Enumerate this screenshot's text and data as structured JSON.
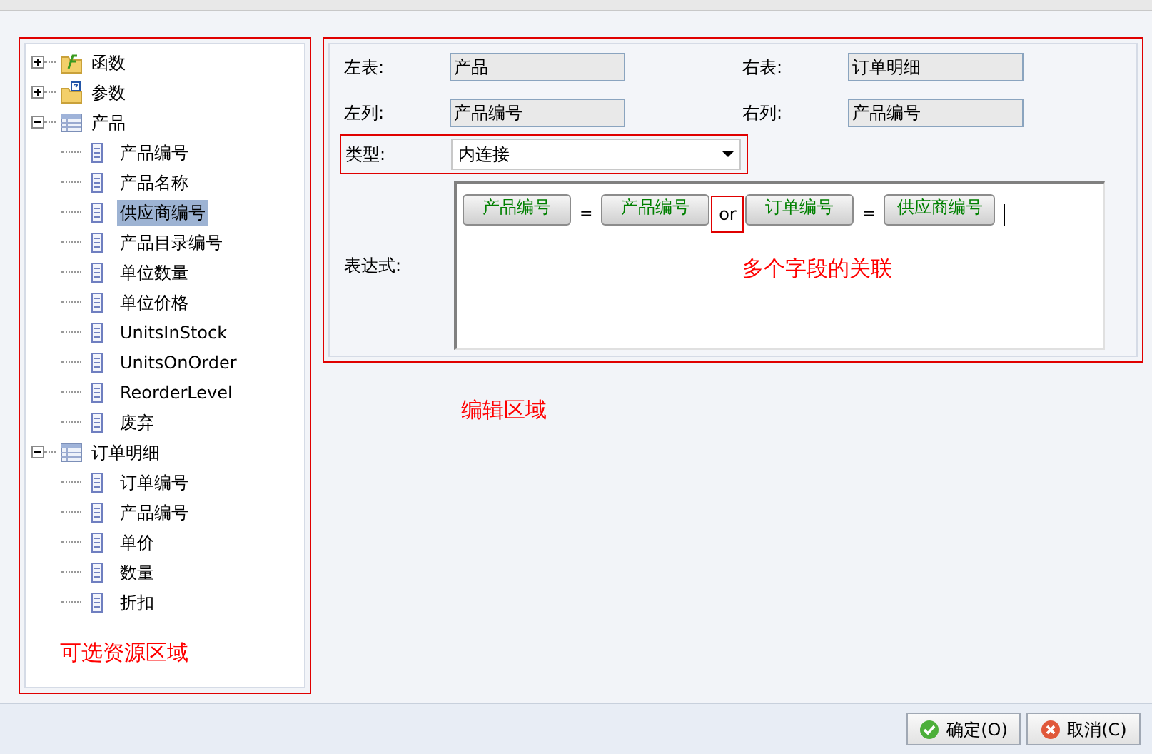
{
  "tree": [
    {
      "label": "函数",
      "kind": "function",
      "expanded": false,
      "selected": false
    },
    {
      "label": "参数",
      "kind": "parameter",
      "expanded": false,
      "selected": false
    },
    {
      "label": "产品",
      "kind": "table",
      "expanded": true,
      "selected": false,
      "children": [
        {
          "label": "产品编号",
          "kind": "field",
          "selected": false
        },
        {
          "label": "产品名称",
          "kind": "field",
          "selected": false
        },
        {
          "label": "供应商编号",
          "kind": "field",
          "selected": true
        },
        {
          "label": "产品目录编号",
          "kind": "field",
          "selected": false
        },
        {
          "label": "单位数量",
          "kind": "field",
          "selected": false
        },
        {
          "label": "单位价格",
          "kind": "field",
          "selected": false
        },
        {
          "label": "UnitsInStock",
          "kind": "field",
          "selected": false
        },
        {
          "label": "UnitsOnOrder",
          "kind": "field",
          "selected": false
        },
        {
          "label": "ReorderLevel",
          "kind": "field",
          "selected": false
        },
        {
          "label": "废弃",
          "kind": "field",
          "selected": false
        }
      ]
    },
    {
      "label": "订单明细",
      "kind": "table",
      "expanded": true,
      "selected": false,
      "children": [
        {
          "label": "订单编号",
          "kind": "field",
          "selected": false
        },
        {
          "label": "产品编号",
          "kind": "field",
          "selected": false
        },
        {
          "label": "单价",
          "kind": "field",
          "selected": false
        },
        {
          "label": "数量",
          "kind": "field",
          "selected": false
        },
        {
          "label": "折扣",
          "kind": "field",
          "selected": false
        }
      ]
    }
  ],
  "tree_annotation": "可选资源区域",
  "form": {
    "left_table": {
      "label": "左表:",
      "value": "产品"
    },
    "right_table": {
      "label": "右表:",
      "value": "订单明细"
    },
    "left_column": {
      "label": "左列:",
      "value": "产品编号"
    },
    "right_column": {
      "label": "右列:",
      "value": "产品编号"
    },
    "type": {
      "label": "类型:",
      "value": "内连接"
    },
    "expression": {
      "label": "表达式:",
      "tokens": [
        {
          "kind": "field",
          "text": "产品编号"
        },
        {
          "kind": "operator",
          "text": "="
        },
        {
          "kind": "field",
          "text": "产品编号"
        },
        {
          "kind": "logic",
          "text": "or"
        },
        {
          "kind": "field",
          "text": "订单编号"
        },
        {
          "kind": "operator",
          "text": "="
        },
        {
          "kind": "field",
          "text": "供应商编号"
        }
      ],
      "annotation": "多个字段的关联"
    }
  },
  "edit_annotation": "编辑区域",
  "buttons": [
    {
      "label": "确定(O)",
      "kind": "ok"
    },
    {
      "label": "取消(C)",
      "kind": "cancel"
    }
  ]
}
